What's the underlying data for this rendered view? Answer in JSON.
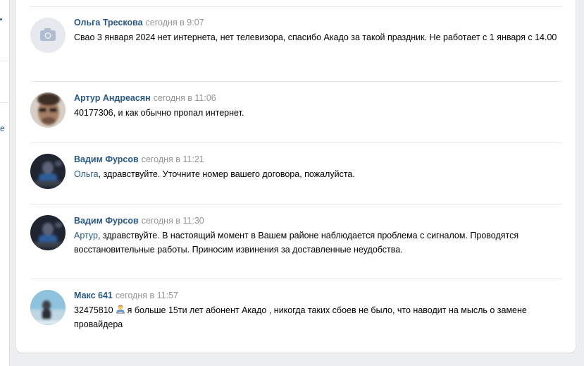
{
  "comments": [
    {
      "author": "Ольга Трескова",
      "time": "сегодня в 9:07",
      "text": "Сваo 3 января 2024 нет интернета, нет телевизора, спасибо Акадо за такой праздник. Не работает с 1 января с 14.00",
      "avatar": "camera-placeholder-icon"
    },
    {
      "author": "Артур Андреасян",
      "time": "сегодня в 11:06",
      "text": "40177306, и как обычно пропал интернет.",
      "avatar": "user-photo"
    },
    {
      "author": "Вадим Фурсов",
      "time": "сегодня в 11:21",
      "mention": "Ольга",
      "text": ", здравствуйте. Уточните номер вашего договора, пожалуйста.",
      "avatar": "user-photo"
    },
    {
      "author": "Вадим Фурсов",
      "time": "сегодня в 11:30",
      "mention": "Артур",
      "text": ", здравствуйте. В настоящий момент в Вашем районе наблюдается проблема с сигналом. Проводятся восстановительные работы. Приносим извинения за доставленные неудобства.",
      "avatar": "user-photo"
    },
    {
      "author": "Макс 641",
      "time": "сегодня в 11:57",
      "text_before": "32475810",
      "emoji": "person-at-laptop-emoji",
      "text": "я больше 15ти лет абонент Акадо , никогда таких сбоев не было, что наводит на мысль о замене провайдера",
      "avatar": "user-photo"
    }
  ],
  "colors": {
    "link": "#2a5885",
    "meta": "#939393",
    "background": "#edeef0",
    "card": "#ffffff"
  }
}
